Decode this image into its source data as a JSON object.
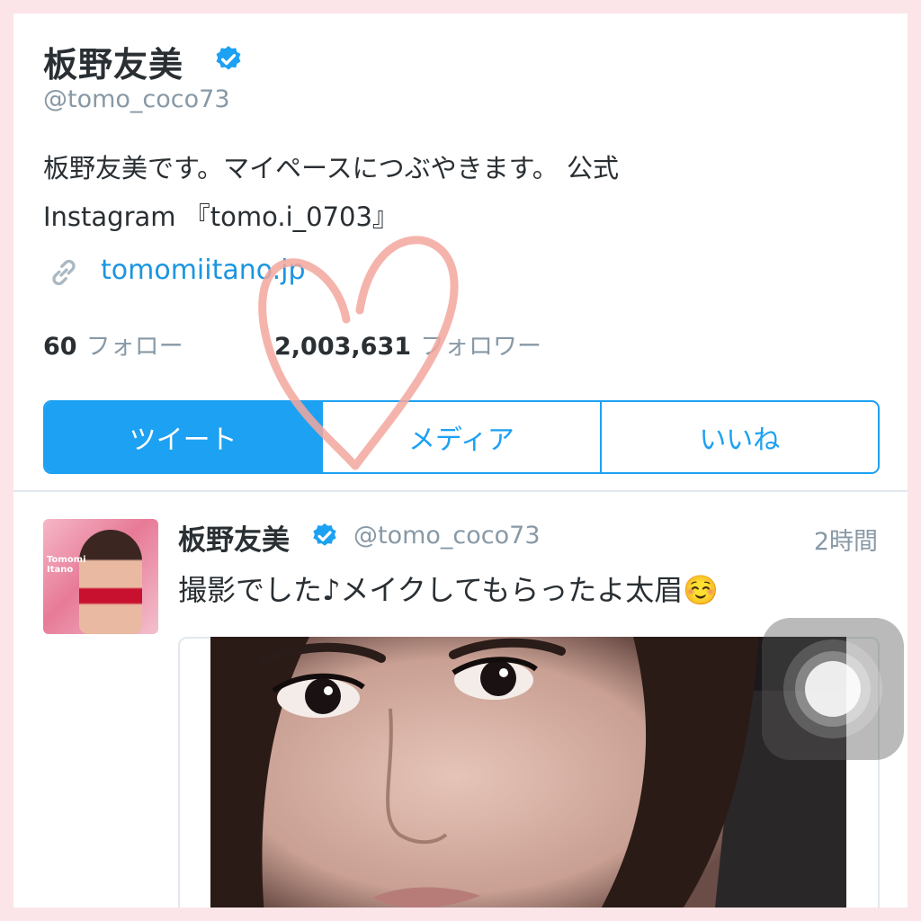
{
  "profile": {
    "name": "板野友美",
    "handle": "@tomo_coco73",
    "bio_line1": "板野友美です。マイペースにつぶやきます。 公式",
    "bio_line2": "Instagram 『tomo.i_0703』",
    "link": "tomomiitano.jp",
    "following_count": "60",
    "following_label": "フォロー",
    "followers_count": "2,003,631",
    "followers_label": "フォロワー",
    "verified_icon": "verified-badge-icon",
    "link_icon": "link-icon"
  },
  "tabs": [
    {
      "label": "ツイート",
      "active": true
    },
    {
      "label": "メディア",
      "active": false
    },
    {
      "label": "いいね",
      "active": false
    }
  ],
  "tweet": {
    "name": "板野友美",
    "handle": "@tomo_coco73",
    "time": "2時間",
    "text": "撮影でした♪メイクしてもらったよ太眉☺️",
    "avatar_text": "Tomomi Itano"
  },
  "colors": {
    "accent": "#1da1f2",
    "link": "#1b95e0",
    "heart": "#f2a79e",
    "background_border": "#fbe5e8"
  }
}
